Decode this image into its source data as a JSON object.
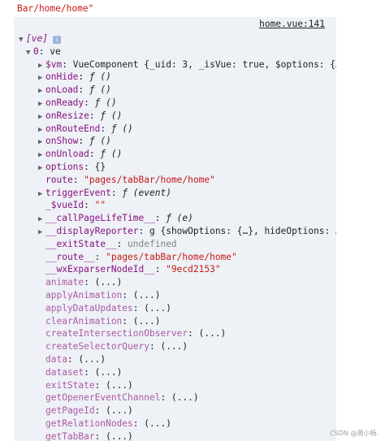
{
  "header_text": "Bar/home/home\"",
  "source_link": "home.vue:141",
  "watermark": "CSDN @周小杨.",
  "tree": [
    {
      "indent": 0,
      "tri": "down",
      "key": "[ve]",
      "keyStyle": "italic",
      "badge": "i"
    },
    {
      "indent": 1,
      "tri": "down",
      "key": "0",
      "sep": ": ",
      "val": "ve",
      "valType": "plain"
    },
    {
      "indent": 2,
      "tri": "right",
      "key": "$vm",
      "sep": ": ",
      "val": "VueComponent {_uid: 3, _isVue: true, $options: {…",
      "valType": "plain"
    },
    {
      "indent": 2,
      "tri": "right",
      "key": "onHide",
      "sep": ": ",
      "val": "ƒ ()",
      "valType": "fn"
    },
    {
      "indent": 2,
      "tri": "right",
      "key": "onLoad",
      "sep": ": ",
      "val": "ƒ ()",
      "valType": "fn"
    },
    {
      "indent": 2,
      "tri": "right",
      "key": "onReady",
      "sep": ": ",
      "val": "ƒ ()",
      "valType": "fn"
    },
    {
      "indent": 2,
      "tri": "right",
      "key": "onResize",
      "sep": ": ",
      "val": "ƒ ()",
      "valType": "fn"
    },
    {
      "indent": 2,
      "tri": "right",
      "key": "onRouteEnd",
      "sep": ": ",
      "val": "ƒ ()",
      "valType": "fn"
    },
    {
      "indent": 2,
      "tri": "right",
      "key": "onShow",
      "sep": ": ",
      "val": "ƒ ()",
      "valType": "fn"
    },
    {
      "indent": 2,
      "tri": "right",
      "key": "onUnload",
      "sep": ": ",
      "val": "ƒ ()",
      "valType": "fn"
    },
    {
      "indent": 2,
      "tri": "right",
      "key": "options",
      "sep": ": ",
      "val": "{}",
      "valType": "plain"
    },
    {
      "indent": 2,
      "tri": "none",
      "key": "route",
      "sep": ": ",
      "val": "\"pages/tabBar/home/home\"",
      "valType": "str"
    },
    {
      "indent": 2,
      "tri": "right",
      "key": "triggerEvent",
      "sep": ": ",
      "val": "ƒ (event)",
      "valType": "fn"
    },
    {
      "indent": 2,
      "tri": "none",
      "key": "_$vueId",
      "sep": ": ",
      "val": "\"\"",
      "valType": "str"
    },
    {
      "indent": 2,
      "tri": "right",
      "key": "__callPageLifeTime__",
      "sep": ": ",
      "val": "ƒ (e)",
      "valType": "fn"
    },
    {
      "indent": 2,
      "tri": "right",
      "key": "__displayReporter",
      "sep": ": ",
      "val": "g {showOptions: {…}, hideOptions: …",
      "valType": "plain"
    },
    {
      "indent": 2,
      "tri": "none",
      "key": "__exitState__",
      "sep": ": ",
      "val": "undefined",
      "valType": "undef"
    },
    {
      "indent": 2,
      "tri": "none",
      "key": "__route__",
      "sep": ": ",
      "val": "\"pages/tabBar/home/home\"",
      "valType": "str"
    },
    {
      "indent": 2,
      "tri": "none",
      "key": "__wxExparserNodeId__",
      "sep": ": ",
      "val": "\"9ecd2153\"",
      "valType": "str"
    },
    {
      "indent": 2,
      "tri": "none",
      "key": "animate",
      "sep": ": ",
      "val": "(...)",
      "valType": "plain",
      "faded": true
    },
    {
      "indent": 2,
      "tri": "none",
      "key": "applyAnimation",
      "sep": ": ",
      "val": "(...)",
      "valType": "plain",
      "faded": true
    },
    {
      "indent": 2,
      "tri": "none",
      "key": "applyDataUpdates",
      "sep": ": ",
      "val": "(...)",
      "valType": "plain",
      "faded": true
    },
    {
      "indent": 2,
      "tri": "none",
      "key": "clearAnimation",
      "sep": ": ",
      "val": "(...)",
      "valType": "plain",
      "faded": true
    },
    {
      "indent": 2,
      "tri": "none",
      "key": "createIntersectionObserver",
      "sep": ": ",
      "val": "(...)",
      "valType": "plain",
      "faded": true
    },
    {
      "indent": 2,
      "tri": "none",
      "key": "createSelectorQuery",
      "sep": ": ",
      "val": "(...)",
      "valType": "plain",
      "faded": true
    },
    {
      "indent": 2,
      "tri": "none",
      "key": "data",
      "sep": ": ",
      "val": "(...)",
      "valType": "plain",
      "faded": true
    },
    {
      "indent": 2,
      "tri": "none",
      "key": "dataset",
      "sep": ": ",
      "val": "(...)",
      "valType": "plain",
      "faded": true
    },
    {
      "indent": 2,
      "tri": "none",
      "key": "exitState",
      "sep": ": ",
      "val": "(...)",
      "valType": "plain",
      "faded": true
    },
    {
      "indent": 2,
      "tri": "none",
      "key": "getOpenerEventChannel",
      "sep": ": ",
      "val": "(...)",
      "valType": "plain",
      "faded": true
    },
    {
      "indent": 2,
      "tri": "none",
      "key": "getPageId",
      "sep": ": ",
      "val": "(...)",
      "valType": "plain",
      "faded": true
    },
    {
      "indent": 2,
      "tri": "none",
      "key": "getRelationNodes",
      "sep": ": ",
      "val": "(...)",
      "valType": "plain",
      "faded": true
    },
    {
      "indent": 2,
      "tri": "none",
      "key": "getTabBar",
      "sep": ": ",
      "val": "(...)",
      "valType": "plain",
      "faded": true
    }
  ]
}
